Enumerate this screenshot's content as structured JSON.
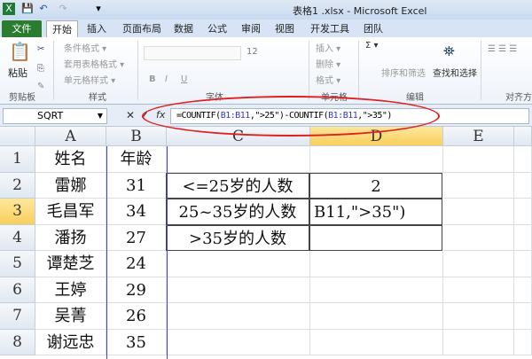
{
  "window": {
    "title": "表格1 .xlsx - Microsoft Excel"
  },
  "quick_access": {
    "save": "💾",
    "undo": "↶",
    "redo": "↷",
    "more": "▾"
  },
  "tabs": [
    "文件",
    "开始",
    "插入",
    "页面布局",
    "数据",
    "公式",
    "审阅",
    "视图",
    "开发工具",
    "团队"
  ],
  "ribbon": {
    "clipboard": {
      "paste": "粘贴",
      "group": "剪贴板"
    },
    "styles": {
      "items": [
        "条件格式 ▾",
        "套用表格格式 ▾",
        "单元格样式 ▾"
      ],
      "group": "样式"
    },
    "font": {
      "size": "12",
      "group": "字体",
      "buttons": [
        "B",
        "I",
        "U"
      ]
    },
    "cells": {
      "items": [
        "插入 ▾",
        "删除 ▾",
        "格式 ▾"
      ],
      "group": "单元格"
    },
    "editing": {
      "sort": "排序和筛选",
      "find": "查找和选择",
      "sum": "Σ ▾",
      "group": "编辑"
    },
    "alignment": {
      "group": "对齐方"
    }
  },
  "formula_bar": {
    "name_box": "SQRT",
    "fx": "fx",
    "formula_parts": [
      "=COUNTIF(",
      "B1:B11",
      ",\">25\")-COUNTIF(",
      "B1:B11",
      ",\">35\")"
    ]
  },
  "columns": [
    "A",
    "B",
    "C",
    "D",
    "E"
  ],
  "rows": [
    "1",
    "2",
    "3",
    "4",
    "5",
    "6",
    "7",
    "8"
  ],
  "cells": [
    [
      "姓名",
      "年龄",
      "",
      ""
    ],
    [
      "雷娜",
      "31",
      "<=25岁的人数",
      "2"
    ],
    [
      "毛昌军",
      "34",
      "25~35岁的人数",
      "B11,\">35\")"
    ],
    [
      "潘扬",
      "27",
      ">35岁的人数",
      ""
    ],
    [
      "谭楚芝",
      "24",
      "",
      ""
    ],
    [
      "王婷",
      "29",
      "",
      ""
    ],
    [
      "吴菁",
      "26",
      "",
      ""
    ],
    [
      "谢远忠",
      "35",
      "",
      ""
    ]
  ]
}
